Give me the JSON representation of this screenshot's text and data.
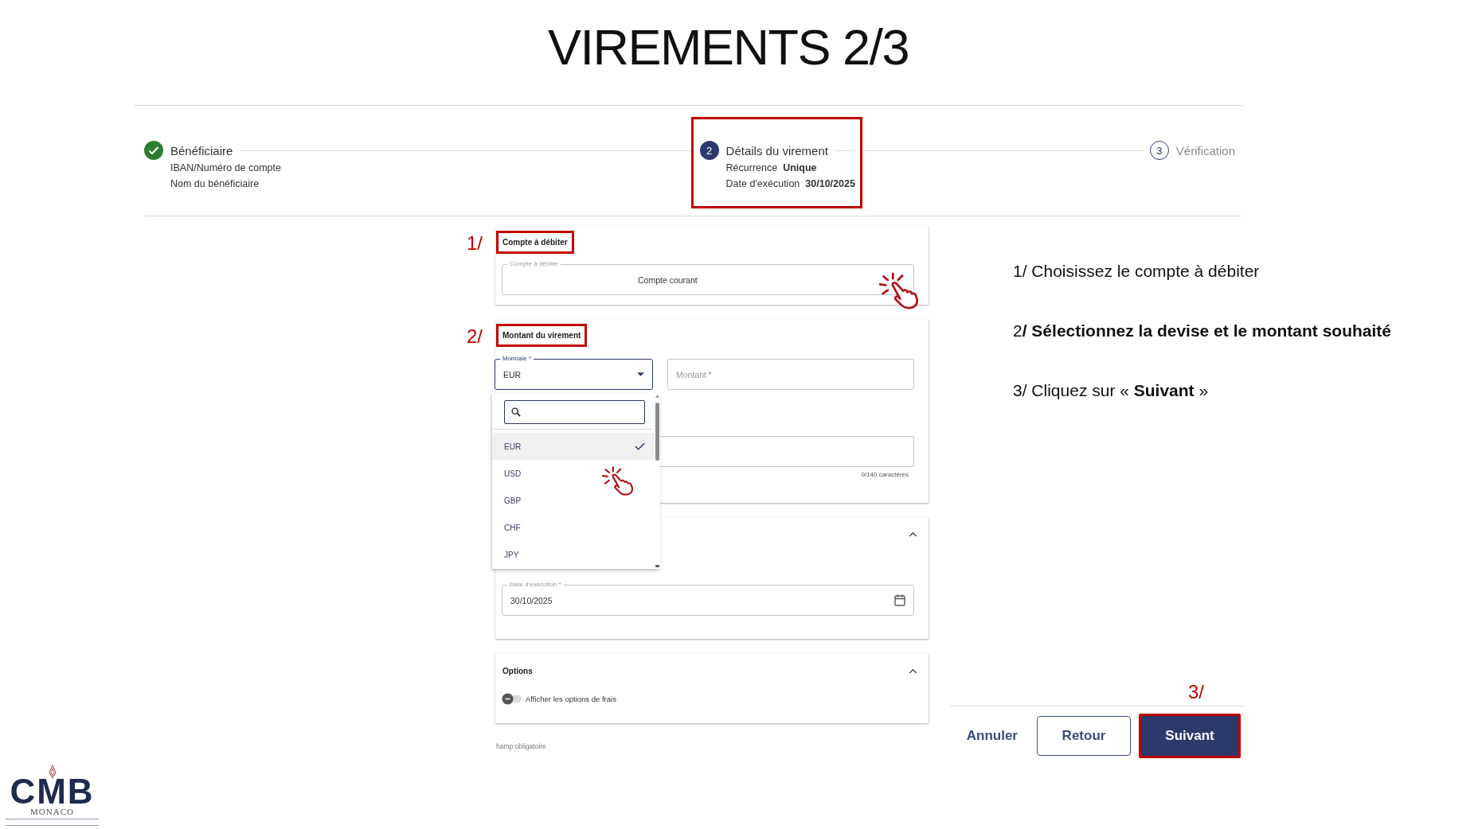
{
  "slide": {
    "title": "VIREMENTS 2/3"
  },
  "stepper": {
    "steps": [
      {
        "kind": "done",
        "label": "Bénéficiaire",
        "highlighted": false,
        "details": [
          {
            "label": "IBAN/Numéro de compte"
          },
          {
            "label": "Nom du bénéficiaire"
          }
        ]
      },
      {
        "kind": "current",
        "number": "2",
        "label": "Détails du virement",
        "highlighted": true,
        "details": [
          {
            "label": "Récurrence",
            "value": "Unique"
          },
          {
            "label": "Date d'exécution",
            "value": "30/10/2025"
          }
        ]
      },
      {
        "kind": "upcoming",
        "number": "3",
        "label": "Vérification",
        "highlighted": false
      }
    ]
  },
  "form": {
    "sections": [
      {
        "kind": "account",
        "annotation": "1/",
        "title": "Compte à débiter",
        "title_highlighted": true,
        "field": {
          "label": "Compte à débiter",
          "value": "Compte courant",
          "pointer": true
        }
      },
      {
        "kind": "amount",
        "annotation": "2/",
        "title": "Montant du virement",
        "title_highlighted": true,
        "currency": {
          "label": "Monnaie *",
          "value": "EUR",
          "focused": true,
          "expanded": true,
          "options": [
            {
              "label": "EUR",
              "selected": true,
              "pointer": false
            },
            {
              "label": "USD",
              "selected": false,
              "pointer": true
            },
            {
              "label": "GBP",
              "selected": false,
              "pointer": false
            },
            {
              "label": "CHF",
              "selected": false,
              "pointer": false
            },
            {
              "label": "JPY",
              "selected": false,
              "pointer": false
            }
          ]
        },
        "amount": {
          "placeholder": "Montant *"
        },
        "comment": {
          "counter": "0/140 caractères"
        }
      },
      {
        "kind": "date",
        "expanded": true,
        "field": {
          "label": "Date d'exécution *",
          "value": "30/10/2025"
        }
      },
      {
        "kind": "options",
        "title": "Options",
        "title_highlighted": false,
        "expanded": true,
        "toggle": {
          "label": "Afficher les options de frais",
          "on": false
        }
      }
    ],
    "footnote": "hamp obligatoire"
  },
  "instructions": [
    "1/ Choisissez le compte à débiter",
    "2**/ Sélectionnez la devise et le montant souhaité**",
    "3/ Cliquez sur « **Suivant** »"
  ],
  "actions": {
    "annotation": "3/",
    "buttons": [
      {
        "kind": "text",
        "label": "Annuler",
        "highlighted": false
      },
      {
        "kind": "outlined",
        "label": "Retour",
        "highlighted": false
      },
      {
        "kind": "primary",
        "label": "Suivant",
        "highlighted": true
      }
    ]
  },
  "logo": {
    "wordmark": "CMB",
    "subtitle": "MONACO"
  }
}
